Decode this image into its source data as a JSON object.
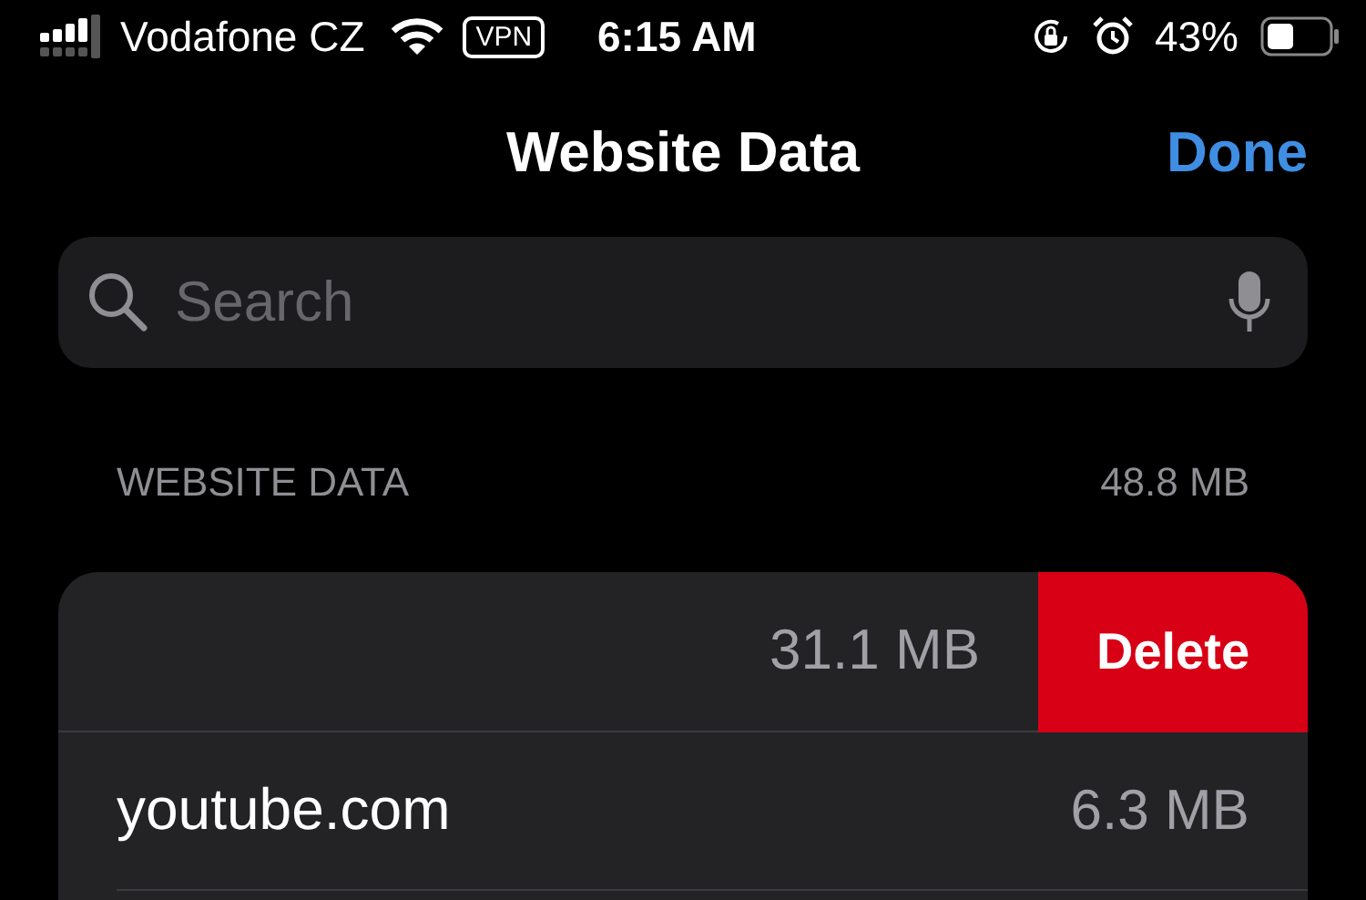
{
  "status_bar": {
    "carrier": "Vodafone CZ",
    "vpn": "VPN",
    "time": "6:15 AM",
    "battery": "43%"
  },
  "nav": {
    "title": "Website Data",
    "done": "Done"
  },
  "search": {
    "placeholder": "Search"
  },
  "section": {
    "title": "WEBSITE DATA",
    "total": "48.8 MB"
  },
  "rows": [
    {
      "kind": "swiped",
      "size": "31.1 MB",
      "action": "Delete"
    },
    {
      "kind": "plain",
      "site": "youtube.com",
      "size": "6.3 MB"
    }
  ]
}
